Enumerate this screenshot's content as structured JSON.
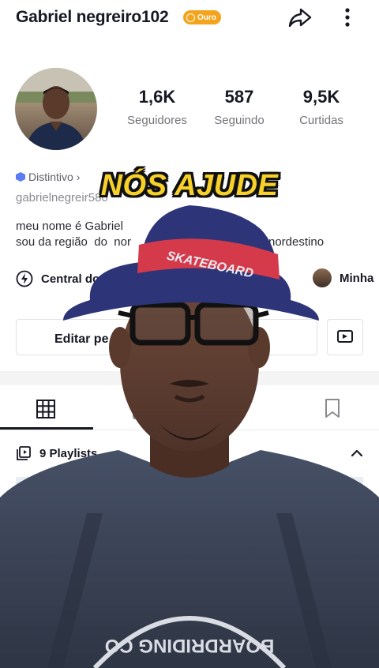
{
  "header": {
    "username": "Gabriel negreiro102",
    "badge_label": "Ouro",
    "share_icon": "share-arrow-icon",
    "more_icon": "vertical-dots-icon"
  },
  "stats": [
    {
      "value": "1,6K",
      "label": "Seguidores"
    },
    {
      "value": "587",
      "label": "Seguindo"
    },
    {
      "value": "9,5K",
      "label": "Curtidas"
    }
  ],
  "profile": {
    "distintivo": "Distintivo",
    "handle": "gabrielnegreir580",
    "bio_line1": "meu nome é Gabriel",
    "bio_line2_start": "sou da região  do  nor",
    "bio_line2_end": "nordestino"
  },
  "links": {
    "central": "Central do C",
    "minha": "Minha"
  },
  "buttons": {
    "edit": "Editar pe"
  },
  "tabs": [
    "videos-grid-icon",
    "lock-icon",
    "bookmark-icon"
  ],
  "playlists": {
    "label": "9 Playlists"
  },
  "overlay": {
    "caption": "NÓS AJUDE",
    "hat_text": "SKATEBOARD",
    "shirt_text": "BOARDRIDING CO"
  },
  "colors": {
    "badge": "#f4a41c",
    "caption": "#f7d12a",
    "hat_band": "#d43a4a",
    "hat": "#2d3478",
    "shirt": "#3b4252"
  }
}
